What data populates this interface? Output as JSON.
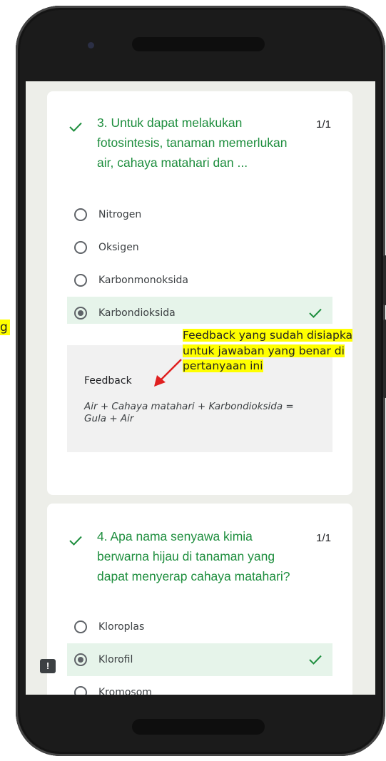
{
  "left_note": "g",
  "annotation": {
    "line1": "Feedback yang sudah disiapka",
    "line2": "untuk jawaban yang benar di",
    "line3": "pertanyaan ini",
    "highlight_color": "#ffff00",
    "arrow_color": "#e02020"
  },
  "colors": {
    "correct_green": "#1e8e3e",
    "correct_bg": "#e6f4ea",
    "screen_bg": "#edeee9"
  },
  "questions": [
    {
      "number_text": "3. Untuk dapat melakukan fotosintesis, tanaman memerlukan air, cahaya matahari dan ...",
      "line1": "3. Untuk dapat melakukan",
      "line2": "fotosintesis, tanaman memerlukan",
      "line3": "air, cahaya matahari dan ...",
      "score": "1/1",
      "options": [
        {
          "label": "Nitrogen",
          "selected": false,
          "correct": false
        },
        {
          "label": "Oksigen",
          "selected": false,
          "correct": false
        },
        {
          "label": "Karbonmonoksida",
          "selected": false,
          "correct": false
        },
        {
          "label": "Karbondioksida",
          "selected": true,
          "correct": true
        }
      ],
      "feedback_title": "Feedback",
      "feedback_line1": "Air + Cahaya matahari + Karbondioksida =",
      "feedback_line2": "Gula + Air"
    },
    {
      "line1": "4. Apa nama senyawa kimia",
      "line2": "berwarna hijau di tanaman yang",
      "line3": "dapat menyerap cahaya matahari?",
      "score": "1/1",
      "options": [
        {
          "label": "Kloroplas",
          "selected": false,
          "correct": false
        },
        {
          "label": "Klorofil",
          "selected": true,
          "correct": true
        },
        {
          "label": "Kromosom",
          "selected": false,
          "correct": false
        }
      ]
    }
  ],
  "report_icon": "feedback-report-icon",
  "report_glyph": "!"
}
